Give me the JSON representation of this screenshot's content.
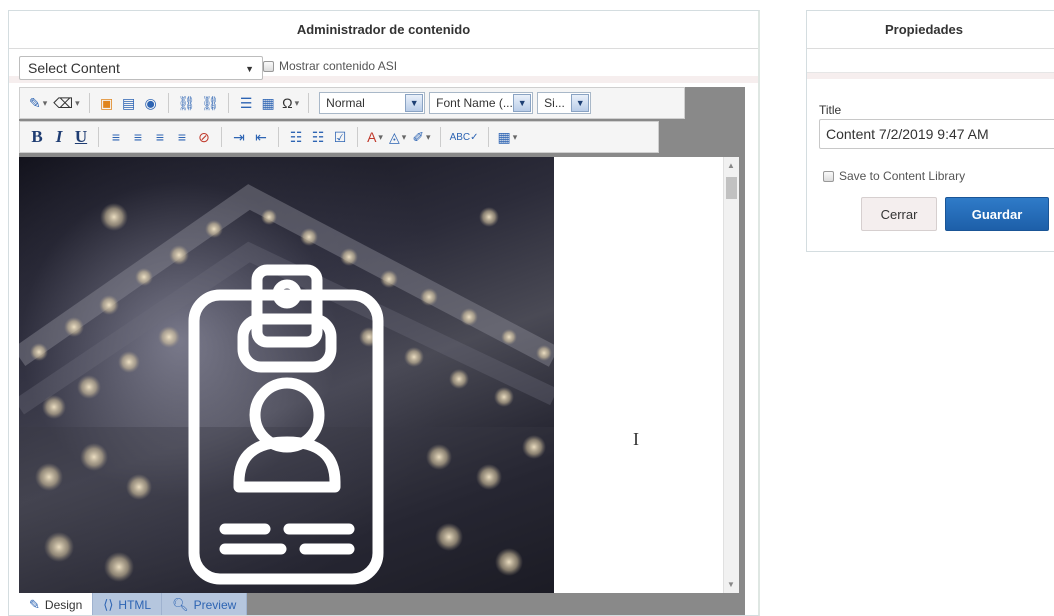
{
  "content_manager": {
    "title": "Administrador de contenido",
    "select_value": "Select Content",
    "asi_checkbox_label": "Mostrar contenido ASI"
  },
  "editor": {
    "format_dropdown": "Normal",
    "font_name_dropdown": "Font Name (...",
    "size_dropdown": "Si...",
    "bold_label": "B",
    "italic_label": "I",
    "underline_label": "U",
    "omega_label": "Ω",
    "mode_tabs": [
      "Design",
      "HTML",
      "Preview"
    ],
    "active_mode": "Design"
  },
  "properties": {
    "title": "Propiedades",
    "title_field_label": "Title",
    "title_field_value": "Content 7/2/2019 9:47 AM",
    "save_library_label": "Save to Content Library",
    "close_button": "Cerrar",
    "save_button": "Guardar"
  },
  "colors": {
    "accent_blue": "#2d64b3",
    "save_button_bg": "#1d5fa9",
    "close_button_bg": "#f4eeee"
  }
}
